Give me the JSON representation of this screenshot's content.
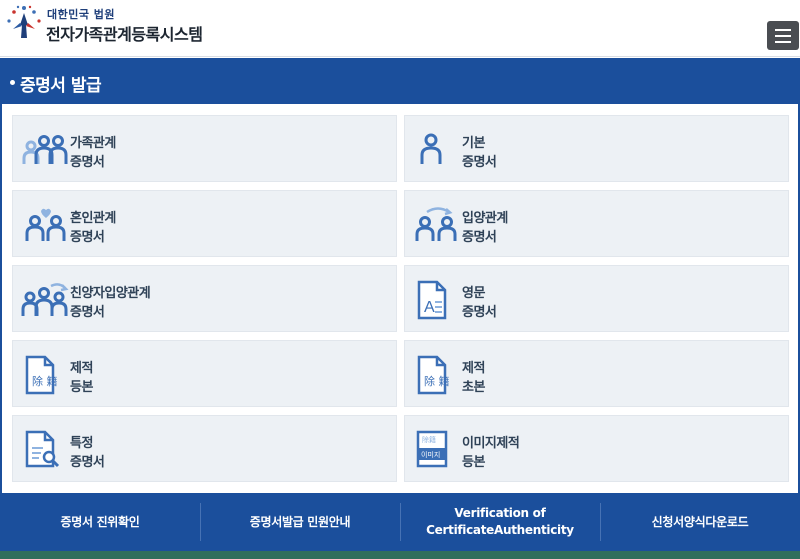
{
  "header": {
    "org": "대한민국 법원",
    "system_name": "전자가족관계등록시스템"
  },
  "page": {
    "title": "증명서 발급"
  },
  "cards": [
    {
      "line1": "가족관계",
      "line2": "증명서",
      "icon": "family-icon"
    },
    {
      "line1": "기본",
      "line2": "증명서",
      "icon": "person-icon"
    },
    {
      "line1": "혼인관계",
      "line2": "증명서",
      "icon": "couple-heart-icon"
    },
    {
      "line1": "입양관계",
      "line2": "증명서",
      "icon": "adoption-icon"
    },
    {
      "line1": "친양자입양관계",
      "line2": "증명서",
      "icon": "family-arrow-icon"
    },
    {
      "line1": "영문",
      "line2": "증명서",
      "icon": "english-document-icon"
    },
    {
      "line1": "제적",
      "line2": "등본",
      "icon": "removed-record-icon",
      "icon_text": "除 籍"
    },
    {
      "line1": "제적",
      "line2": "초본",
      "icon": "removed-record-icon",
      "icon_text": "除 籍"
    },
    {
      "line1": "특정",
      "line2": "증명서",
      "icon": "document-search-icon"
    },
    {
      "line1": "이미지제적",
      "line2": "등본",
      "icon": "image-record-icon",
      "icon_text": "이미지",
      "icon_subtext": "除籍"
    }
  ],
  "footer": {
    "items": [
      {
        "label": "증명서 진위확인"
      },
      {
        "label": "증명서발급 민원안내"
      },
      {
        "label": "Verification of CertificateAuthenticity"
      },
      {
        "label": "신청서양식다운로드"
      }
    ]
  },
  "colors": {
    "primary": "#1b4f9c",
    "card_bg": "#edf1f5",
    "icon_blue": "#3b6fb6",
    "icon_light": "#7ea7dc"
  }
}
